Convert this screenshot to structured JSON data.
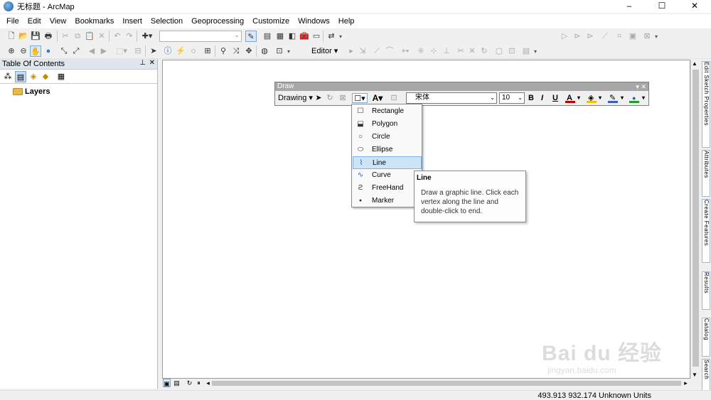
{
  "window": {
    "title": "无标题 - ArcMap",
    "minimize": "–",
    "maximize": "☐",
    "close": "✕"
  },
  "menubar": [
    "File",
    "Edit",
    "View",
    "Bookmarks",
    "Insert",
    "Selection",
    "Geoprocessing",
    "Customize",
    "Windows",
    "Help"
  ],
  "toolbar": {
    "editor_label": "Editor ▾"
  },
  "toc": {
    "title": "Table Of Contents",
    "pin": "ᵖ",
    "close": "✕",
    "root_layer": "Layers"
  },
  "draw_toolbar": {
    "title": "Draw",
    "drawing_menu": "Drawing ▾",
    "font_name": "宋体",
    "font_size": "10",
    "bold": "B",
    "italic": "I",
    "underline": "U",
    "font_color_letter": "A",
    "colors": {
      "font": "#c00000",
      "fill": "#f2c200",
      "line": "#3060d0",
      "marker": "#20a020"
    }
  },
  "shape_menu": {
    "items": [
      {
        "label": "Rectangle",
        "icon": "rectangle-icon"
      },
      {
        "label": "Polygon",
        "icon": "polygon-icon"
      },
      {
        "label": "Circle",
        "icon": "circle-icon"
      },
      {
        "label": "Ellipse",
        "icon": "ellipse-icon"
      },
      {
        "label": "Line",
        "icon": "line-icon",
        "highlighted": true
      },
      {
        "label": "Curve",
        "icon": "curve-icon"
      },
      {
        "label": "FreeHand",
        "icon": "freehand-icon"
      },
      {
        "label": "Marker",
        "icon": "marker-icon"
      }
    ]
  },
  "tooltip": {
    "title": "Line",
    "body": "Draw a graphic line. Click each vertex along the line and double-click to end."
  },
  "dock_tabs": [
    "Edit Sketch Properties",
    "Attributes",
    "Create Features",
    "Results",
    "Catalog",
    "Search"
  ],
  "status": {
    "coordinates": "493.913  932.174 Unknown Units"
  },
  "watermark": {
    "main": "Bai du 经验",
    "sub": "jingyan.baidu.com"
  }
}
